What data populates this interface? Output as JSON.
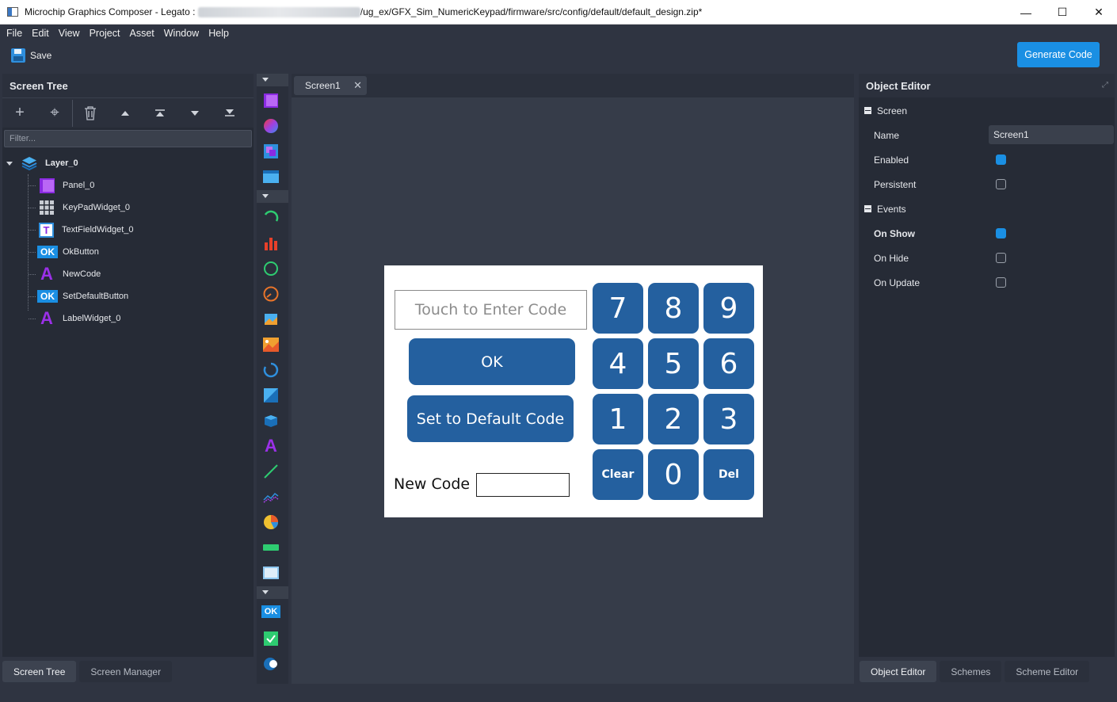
{
  "window": {
    "title_prefix": "Microchip Graphics Composer - Legato : ",
    "title_suffix": "/ug_ex/GFX_Sim_NumericKeypad/firmware/src/config/default/default_design.zip*",
    "controls": {
      "minimize": "—",
      "maximize": "☐",
      "close": "✕"
    }
  },
  "menu": [
    "File",
    "Edit",
    "View",
    "Project",
    "Asset",
    "Window",
    "Help"
  ],
  "toolbar": {
    "save_label": "Save",
    "generate_label": "Generate Code"
  },
  "screen_tree": {
    "header": "Screen Tree",
    "filter_placeholder": "Filter...",
    "tools": {
      "add": "+",
      "target": "⌖",
      "delete": "🗑",
      "up": "▲",
      "top": "⤒",
      "down": "▼",
      "bottom": "⤓"
    },
    "root": {
      "label": "Layer_0",
      "icon": "layer-icon"
    },
    "items": [
      {
        "label": "Panel_0",
        "icon": "panel-icon"
      },
      {
        "label": "KeyPadWidget_0",
        "icon": "keypad-icon"
      },
      {
        "label": "TextFieldWidget_0",
        "icon": "textfield-icon",
        "glyph": "T"
      },
      {
        "label": "OkButton",
        "icon": "button-icon",
        "glyph": "OK"
      },
      {
        "label": "NewCode",
        "icon": "label-icon",
        "glyph": "A"
      },
      {
        "label": "SetDefaultButton",
        "icon": "button-icon",
        "glyph": "OK"
      },
      {
        "label": "LabelWidget_0",
        "icon": "label-icon",
        "glyph": "A"
      }
    ]
  },
  "left_tabs": [
    "Screen Tree",
    "Screen Manager"
  ],
  "palette_glyphs": {
    "ok": "OK",
    "label": "A"
  },
  "document_tab": {
    "label": "Screen1",
    "close": "✕"
  },
  "design": {
    "text_field_placeholder": "Touch to Enter Code",
    "ok_label": "OK",
    "default_label": "Set to Default Code",
    "new_code_label": "New Code",
    "keys": [
      "7",
      "8",
      "9",
      "4",
      "5",
      "6",
      "1",
      "2",
      "3",
      "Clear",
      "0",
      "Del"
    ]
  },
  "object_editor": {
    "header": "Object Editor",
    "groups": [
      {
        "label": "Screen",
        "props": [
          {
            "label": "Name",
            "value": "Screen1"
          },
          {
            "label": "Enabled",
            "checked": true
          },
          {
            "label": "Persistent",
            "checked": false
          }
        ]
      },
      {
        "label": "Events",
        "props": [
          {
            "label": "On Show",
            "checked": true,
            "bold": true
          },
          {
            "label": "On Hide",
            "checked": false
          },
          {
            "label": "On Update",
            "checked": false
          }
        ]
      }
    ]
  },
  "right_tabs": [
    "Object Editor",
    "Schemes",
    "Scheme Editor"
  ],
  "colors": {
    "accent": "#1a8fe3",
    "keypad_blue": "#24609f",
    "panel_bg": "#262b36"
  }
}
